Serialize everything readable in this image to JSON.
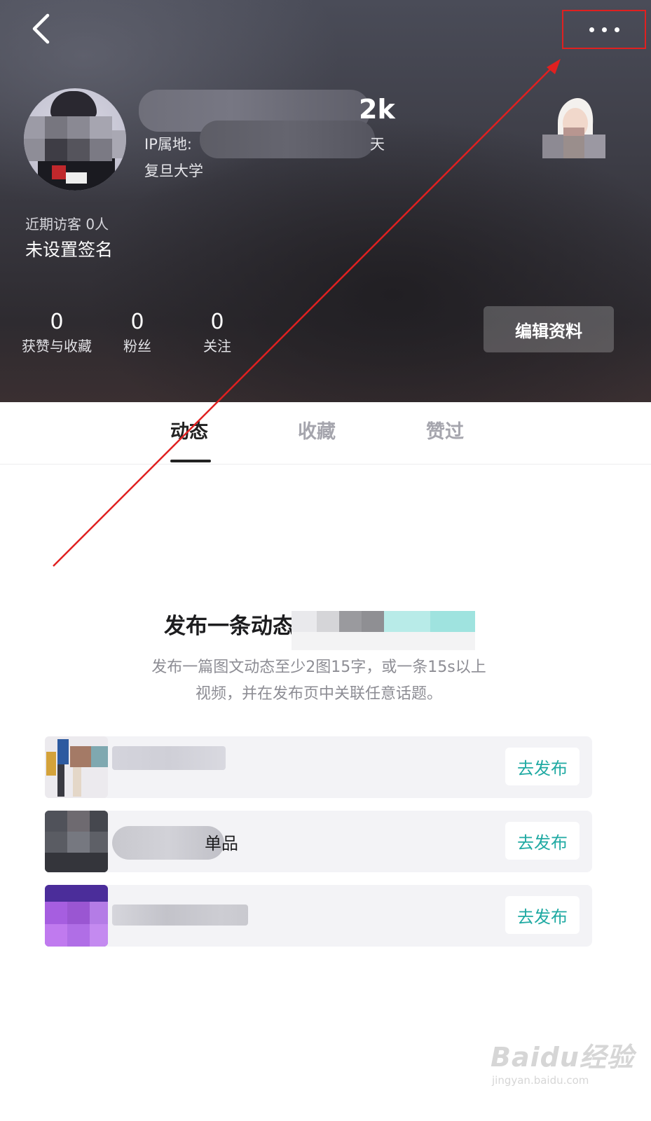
{
  "header": {
    "name_suffix": "2k",
    "ip_prefix": "IP属地: ",
    "ip_suffix": "天",
    "school": "复旦大学",
    "visitors": "近期访客 0人",
    "signature": "未设置签名",
    "stats": [
      {
        "value": "0",
        "label": "获赞与收藏"
      },
      {
        "value": "0",
        "label": "粉丝"
      },
      {
        "value": "0",
        "label": "关注"
      }
    ],
    "edit_label": "编辑资料"
  },
  "tabs": [
    {
      "label": "动态",
      "active": true
    },
    {
      "label": "收藏",
      "active": false
    },
    {
      "label": "赞过",
      "active": false
    }
  ],
  "publish": {
    "title": "发布一条动态",
    "description_line1": "发布一篇图文动态至少2图15字，或一条15s以上",
    "description_line2": "视频，并在发布页中关联任意话题。",
    "tasks": [
      {
        "text": "",
        "button": "去发布"
      },
      {
        "text": "单品",
        "button": "去发布"
      },
      {
        "text": "",
        "button": "去发布"
      }
    ]
  },
  "watermark": {
    "main": "Baidu经验",
    "sub": "jingyan.baidu.com"
  },
  "colors": {
    "accent": "#20aaa3",
    "annotation": "#e02020",
    "active_tab": "#222222",
    "inactive_tab": "#a5a5ad"
  }
}
